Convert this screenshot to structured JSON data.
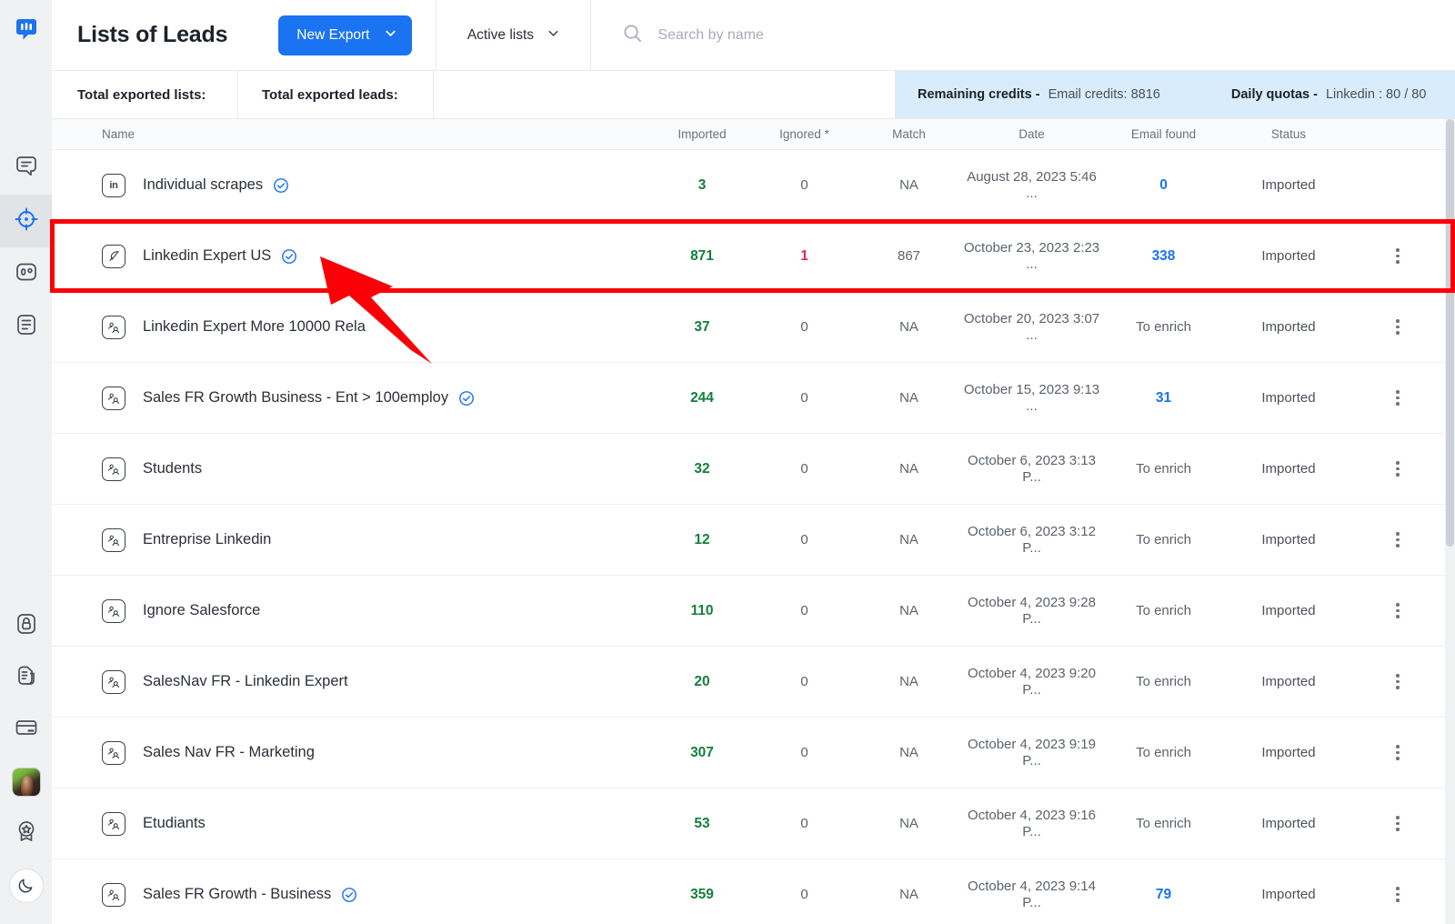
{
  "app": {
    "logo_icon": "lemlist-chat-logo",
    "sidebar": {
      "items": [
        {
          "icon": "message-lines-icon",
          "name": "campaigns",
          "active": false
        },
        {
          "icon": "crosshair-target-icon",
          "name": "leads",
          "active": true
        },
        {
          "icon": "inbox-zero-icon",
          "name": "reports",
          "active": false
        },
        {
          "icon": "document-lines-icon",
          "name": "templates",
          "active": false
        }
      ],
      "bottom_items": [
        {
          "icon": "lock-icon",
          "name": "security"
        },
        {
          "icon": "copy-pages-icon",
          "name": "duplicates"
        },
        {
          "icon": "credit-card-icon",
          "name": "billing"
        },
        {
          "icon": "avatar-photo",
          "name": "user-avatar"
        },
        {
          "icon": "award-badge-icon",
          "name": "rewards"
        },
        {
          "icon": "moon-icon",
          "name": "dark-mode-toggle"
        }
      ]
    }
  },
  "header": {
    "title": "Lists of Leads",
    "new_export_label": "New Export",
    "new_export_chevron": "chevron-down-icon",
    "filter_label": "Active lists",
    "filter_chevron": "chevron-down-icon",
    "search_icon": "search-icon",
    "search_placeholder": "Search by name",
    "search_value": ""
  },
  "totals": {
    "exported_lists_label": "Total exported lists:",
    "exported_lists_value": "",
    "exported_leads_label": "Total exported leads:",
    "exported_leads_value": "",
    "credits": {
      "remaining_label": "Remaining credits -",
      "remaining_value": "Email credits: 8816",
      "quota_label": "Daily quotas -",
      "quota_value": "Linkedin : 80 / 80",
      "background": "#d9ecfb"
    }
  },
  "table": {
    "columns": [
      "Name",
      "Imported",
      "Ignored *",
      "Match",
      "Date",
      "Email found",
      "Status"
    ],
    "rows": [
      {
        "icon": "linkedin-in-icon",
        "name": "Individual scrapes",
        "verified": true,
        "imported": "3",
        "ignored": "0",
        "match": "NA",
        "date": "August 28, 2023 5:46 ...",
        "email_found": "0",
        "email_found_style": "blue",
        "status": "Imported",
        "menu": false,
        "highlighted": false
      },
      {
        "icon": "feather-pen-icon",
        "name": "Linkedin Expert US",
        "verified": true,
        "imported": "871",
        "ignored": "1",
        "ignored_style": "red",
        "match": "867",
        "date": "October 23, 2023 2:23 ...",
        "email_found": "338",
        "email_found_style": "blue",
        "status": "Imported",
        "menu": true,
        "highlighted": true
      },
      {
        "icon": "people-group-icon",
        "name": "Linkedin Expert More 10000 Rela",
        "verified": false,
        "imported": "37",
        "ignored": "0",
        "match": "NA",
        "date": "October 20, 2023 3:07 ...",
        "email_found": "To enrich",
        "email_found_style": "gray",
        "status": "Imported",
        "menu": true,
        "highlighted": false
      },
      {
        "icon": "people-group-icon",
        "name": "Sales FR Growth Business - Ent > 100employ",
        "verified": true,
        "imported": "244",
        "ignored": "0",
        "match": "NA",
        "date": "October 15, 2023 9:13 ...",
        "email_found": "31",
        "email_found_style": "blue",
        "status": "Imported",
        "menu": true,
        "highlighted": false
      },
      {
        "icon": "people-group-icon",
        "name": "Students",
        "verified": false,
        "imported": "32",
        "ignored": "0",
        "match": "NA",
        "date": "October 6, 2023 3:13 P...",
        "email_found": "To enrich",
        "email_found_style": "gray",
        "status": "Imported",
        "menu": true,
        "highlighted": false
      },
      {
        "icon": "people-group-icon",
        "name": "Entreprise Linkedin",
        "verified": false,
        "imported": "12",
        "ignored": "0",
        "match": "NA",
        "date": "October 6, 2023 3:12 P...",
        "email_found": "To enrich",
        "email_found_style": "gray",
        "status": "Imported",
        "menu": true,
        "highlighted": false
      },
      {
        "icon": "people-group-icon",
        "name": "Ignore Salesforce",
        "verified": false,
        "imported": "110",
        "ignored": "0",
        "match": "NA",
        "date": "October 4, 2023 9:28 P...",
        "email_found": "To enrich",
        "email_found_style": "gray",
        "status": "Imported",
        "menu": true,
        "highlighted": false
      },
      {
        "icon": "people-group-icon",
        "name": "SalesNav FR - Linkedin Expert",
        "verified": false,
        "imported": "20",
        "ignored": "0",
        "match": "NA",
        "date": "October 4, 2023 9:20 P...",
        "email_found": "To enrich",
        "email_found_style": "gray",
        "status": "Imported",
        "menu": true,
        "highlighted": false
      },
      {
        "icon": "people-group-icon",
        "name": "Sales Nav FR - Marketing",
        "verified": false,
        "imported": "307",
        "ignored": "0",
        "match": "NA",
        "date": "October 4, 2023 9:19 P...",
        "email_found": "To enrich",
        "email_found_style": "gray",
        "status": "Imported",
        "menu": true,
        "highlighted": false
      },
      {
        "icon": "people-group-icon",
        "name": "Etudiants",
        "verified": false,
        "imported": "53",
        "ignored": "0",
        "match": "NA",
        "date": "October 4, 2023 9:16 P...",
        "email_found": "To enrich",
        "email_found_style": "gray",
        "status": "Imported",
        "menu": true,
        "highlighted": false
      },
      {
        "icon": "people-group-icon",
        "name": "Sales FR Growth - Business",
        "verified": true,
        "imported": "359",
        "ignored": "0",
        "match": "NA",
        "date": "October 4, 2023 9:14 P...",
        "email_found": "79",
        "email_found_style": "blue",
        "status": "Imported",
        "menu": true,
        "highlighted": false
      }
    ]
  },
  "annotation": {
    "highlight_color": "#fb0007",
    "arrow_color": "#fb0007",
    "target_row_name": "Linkedin Expert US"
  },
  "colors": {
    "accent": "#1a73f0",
    "green": "#14803c",
    "red": "#e3276b",
    "credits_bg": "#d9ecfb",
    "sidebar_bg": "#f0f1f3"
  }
}
